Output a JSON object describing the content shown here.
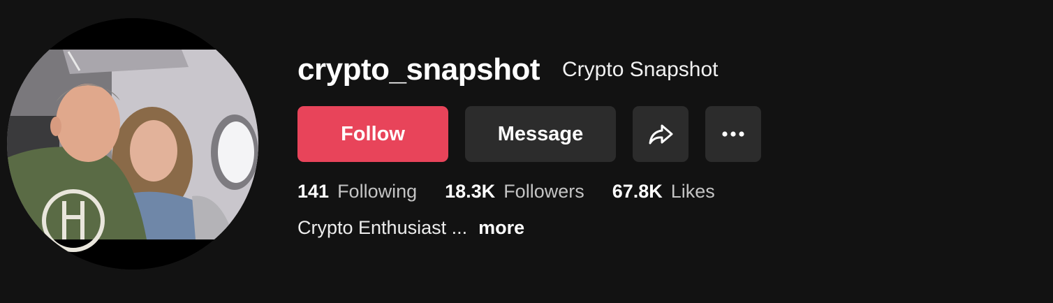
{
  "profile": {
    "username": "crypto_snapshot",
    "display_name": "Crypto Snapshot",
    "avatar_alt": "profile-photo"
  },
  "actions": {
    "follow_label": "Follow",
    "message_label": "Message",
    "share_icon": "share-icon",
    "more_icon": "more-icon"
  },
  "stats": [
    {
      "value": "141",
      "label": "Following"
    },
    {
      "value": "18.3K",
      "label": "Followers"
    },
    {
      "value": "67.8K",
      "label": "Likes"
    }
  ],
  "bio": {
    "text": "Crypto Enthusiast ...",
    "more_label": "more"
  },
  "colors": {
    "background": "#121212",
    "follow_button": "#e8445a",
    "secondary_button": "#2c2c2c"
  }
}
